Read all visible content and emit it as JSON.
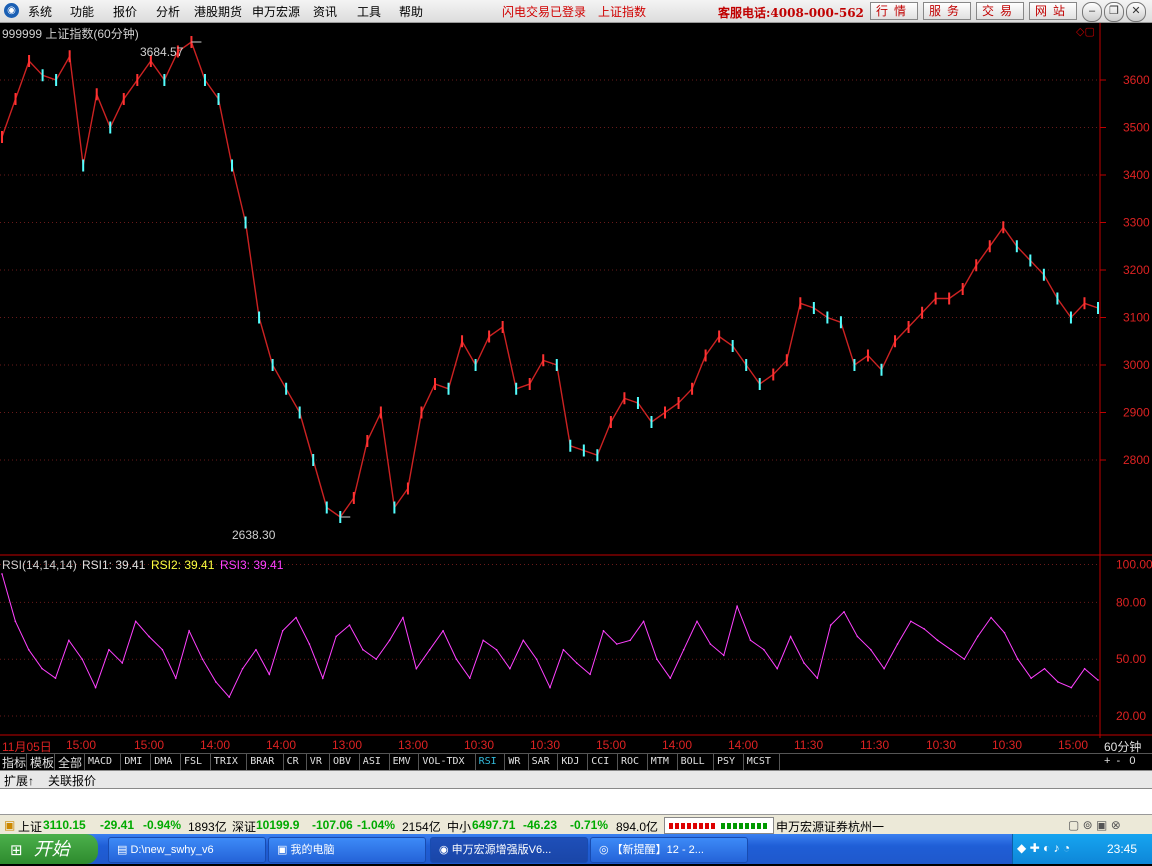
{
  "menu": {
    "items": [
      "系统",
      "功能",
      "报价",
      "分析",
      "港股期货",
      "申万宏源",
      "资讯",
      "工具",
      "帮助"
    ],
    "status_links": [
      "闪电交易已登录",
      "上证指数"
    ],
    "hotline": "客服电话:4008-000-562",
    "buttons": [
      "行情",
      "服务",
      "交易",
      "网站"
    ]
  },
  "chart": {
    "title": "999999 上证指数(60分钟)",
    "high_label": "3684.57",
    "low_label": "2638.30",
    "price_ticks": [
      "3600",
      "3500",
      "3400",
      "3300",
      "3200",
      "3100",
      "3000",
      "2900",
      "2800"
    ],
    "rsi_caption": {
      "name": "RSI(14,14,14)",
      "rsi1": "RSI1: 39.41",
      "rsi2": "RSI2: 39.41",
      "rsi3": "RSI3: 39.41"
    },
    "rsi_ticks": [
      "100.00",
      "80.00",
      "50.00",
      "20.00"
    ],
    "time_labels": [
      "11月05日",
      "15:00",
      "15:00",
      "14:00",
      "14:00",
      "13:00",
      "13:00",
      "10:30",
      "10:30",
      "15:00",
      "14:00",
      "14:00",
      "11:30",
      "11:30",
      "10:30",
      "10:30",
      "15:00"
    ],
    "period": "60分钟",
    "colors": {
      "up": "#ff3232",
      "down": "#54ffff",
      "rsi": "#ff40ff",
      "grid": "#802020",
      "axis": "#c00000"
    }
  },
  "chart_data": [
    {
      "type": "line",
      "title": "999999 上证指数(60分钟)",
      "ylim": [
        2600,
        3720
      ],
      "y": [
        3480,
        3560,
        3640,
        3610,
        3600,
        3650,
        3420,
        3570,
        3500,
        3560,
        3600,
        3640,
        3600,
        3660,
        3680,
        3600,
        3560,
        3420,
        3300,
        3100,
        3000,
        2950,
        2900,
        2800,
        2700,
        2680,
        2720,
        2840,
        2900,
        2700,
        2740,
        2900,
        2960,
        2950,
        3050,
        3000,
        3060,
        3080,
        2950,
        2960,
        3010,
        3000,
        2830,
        2820,
        2810,
        2880,
        2930,
        2920,
        2880,
        2900,
        2920,
        2950,
        3020,
        3060,
        3040,
        3000,
        2960,
        2980,
        3010,
        3130,
        3120,
        3100,
        3090,
        3000,
        3020,
        2990,
        3050,
        3080,
        3110,
        3140,
        3140,
        3160,
        3210,
        3250,
        3290,
        3250,
        3220,
        3190,
        3140,
        3100,
        3130,
        3120
      ]
    },
    {
      "type": "line",
      "title": "RSI(14,14,14)",
      "ylim": [
        10,
        105
      ],
      "y": [
        95,
        70,
        55,
        45,
        40,
        60,
        50,
        35,
        55,
        48,
        70,
        62,
        55,
        40,
        65,
        50,
        38,
        30,
        45,
        55,
        42,
        65,
        72,
        58,
        40,
        62,
        68,
        55,
        50,
        60,
        72,
        45,
        55,
        65,
        50,
        40,
        60,
        55,
        45,
        60,
        50,
        35,
        55,
        48,
        42,
        65,
        58,
        60,
        70,
        50,
        40,
        55,
        70,
        58,
        52,
        78,
        60,
        55,
        45,
        62,
        48,
        40,
        68,
        75,
        62,
        55,
        45,
        58,
        70,
        66,
        60,
        55,
        50,
        62,
        72,
        64,
        50,
        40,
        45,
        38,
        35,
        45,
        39
      ]
    }
  ],
  "indicator_tabs": [
    "指标",
    "模板",
    "全部",
    "MACD",
    "DMI",
    "DMA",
    "FSL",
    "TRIX",
    "BRAR",
    "CR",
    "VR",
    "OBV",
    "ASI",
    "EMV",
    "VOL-TDX",
    "RSI",
    "WR",
    "SAR",
    "KDJ",
    "CCI",
    "ROC",
    "MTM",
    "BOLL",
    "PSY",
    "MCST"
  ],
  "sub_tabs": [
    "扩展↑",
    "关联报价"
  ],
  "status": {
    "sh": {
      "label": "上证",
      "price": "3110.15",
      "chg": "-29.41",
      "pct": "-0.94%",
      "amt": "1893亿"
    },
    "sz": {
      "label": "深证",
      "price": "10199.9",
      "chg": "-107.06",
      "pct": "-1.04%",
      "amt": "2154亿"
    },
    "zx": {
      "label": "中小",
      "price": "6497.71",
      "chg": "-46.23",
      "pct": "-0.71%",
      "amt": "894.0亿"
    },
    "broker": "申万宏源证券杭州一"
  },
  "taskbar": {
    "start": "开始",
    "tasks": [
      "D:\\new_swhy_v6",
      "我的电脑",
      "申万宏源增强版V6...",
      "【新提醒】12 - 2..."
    ],
    "time": "23:45"
  }
}
